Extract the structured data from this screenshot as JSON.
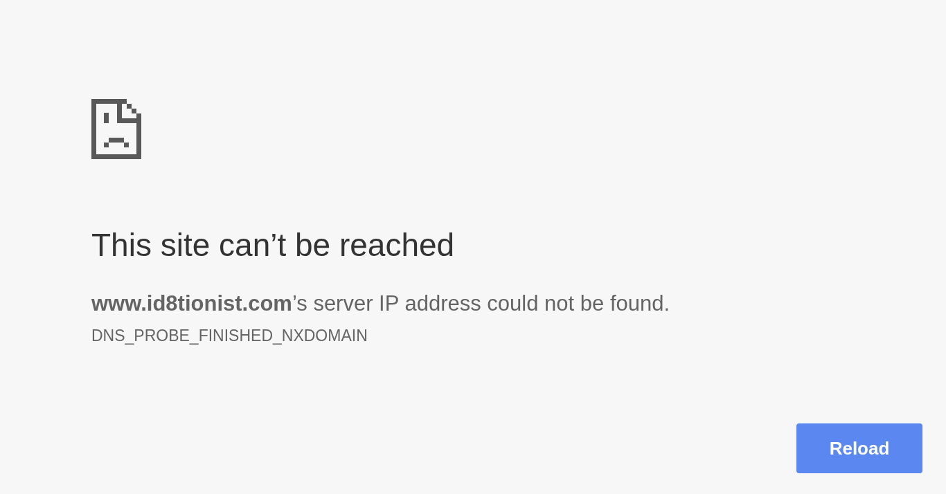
{
  "error_page": {
    "heading": "This site can’t be reached",
    "message": "**www.id8tionist.com**’s server IP address could not be found.",
    "error_code": "DNS_PROBE_FINISHED_NXDOMAIN",
    "reload_button": {
      "label": "Reload"
    }
  }
}
